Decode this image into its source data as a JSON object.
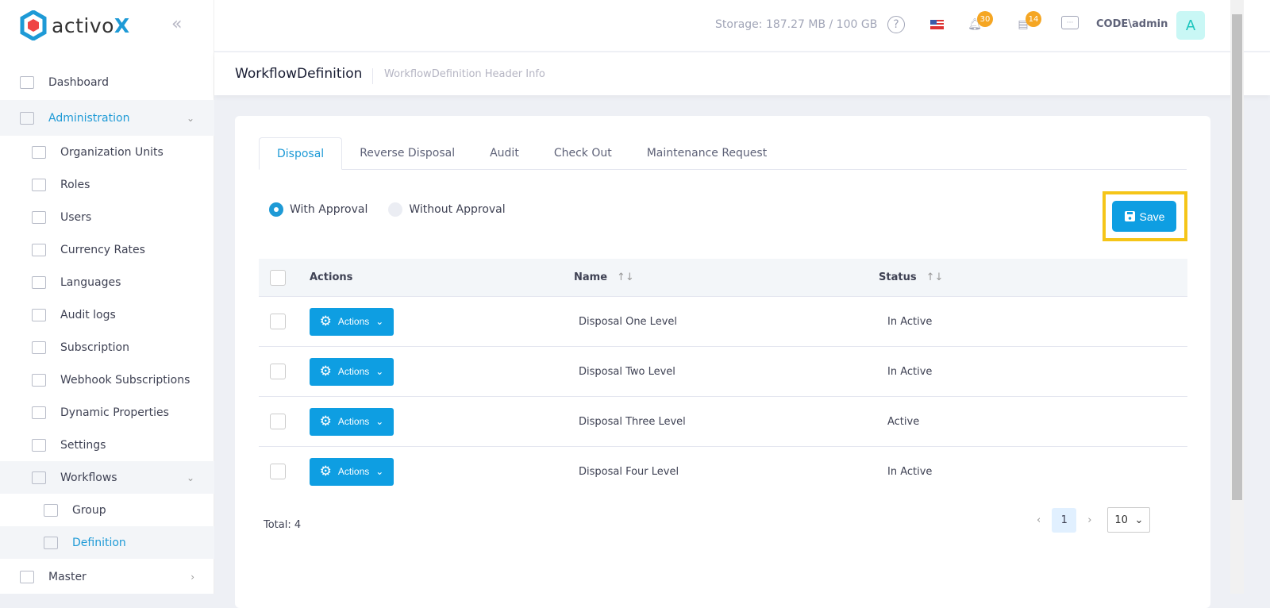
{
  "brand": {
    "name_prefix": "activo",
    "name_suffix": "X"
  },
  "sidebar": {
    "items": [
      {
        "label": "Dashboard",
        "level": 0
      },
      {
        "label": "Administration",
        "level": 0,
        "expanded": true,
        "band": true,
        "active": true
      },
      {
        "label": "Organization Units",
        "level": 1
      },
      {
        "label": "Roles",
        "level": 1
      },
      {
        "label": "Users",
        "level": 1
      },
      {
        "label": "Currency Rates",
        "level": 1
      },
      {
        "label": "Languages",
        "level": 1
      },
      {
        "label": "Audit logs",
        "level": 1
      },
      {
        "label": "Subscription",
        "level": 1
      },
      {
        "label": "Webhook Subscriptions",
        "level": 1
      },
      {
        "label": "Dynamic Properties",
        "level": 1
      },
      {
        "label": "Settings",
        "level": 1
      },
      {
        "label": "Workflows",
        "level": 1,
        "expanded": true,
        "band": true
      },
      {
        "label": "Group",
        "level": 2
      },
      {
        "label": "Definition",
        "level": 2,
        "band": true,
        "active": true
      },
      {
        "label": "Master",
        "level": 0,
        "collapsed": true
      }
    ]
  },
  "topbar": {
    "storage": "Storage: 187.27 MB / 100 GB",
    "notifications_count": "30",
    "tasks_count": "14",
    "user": "CODE\\admin",
    "avatar_letter": "A"
  },
  "header": {
    "title": "WorkflowDefinition",
    "info": "WorkflowDefinition Header Info"
  },
  "tabs": [
    "Disposal",
    "Reverse Disposal",
    "Audit",
    "Check Out",
    "Maintenance Request"
  ],
  "options": {
    "with_approval": "With Approval",
    "without_approval": "Without Approval",
    "selected": "With Approval"
  },
  "save_label": "Save",
  "table": {
    "headers": {
      "actions": "Actions",
      "name": "Name",
      "status": "Status"
    },
    "action_label": "Actions",
    "rows": [
      {
        "name": "Disposal One Level",
        "status": "In Active"
      },
      {
        "name": "Disposal Two Level",
        "status": "In Active"
      },
      {
        "name": "Disposal Three Level",
        "status": "Active"
      },
      {
        "name": "Disposal Four Level",
        "status": "In Active"
      }
    ]
  },
  "footer": {
    "total": "Total: 4",
    "page": "1",
    "page_size": "10"
  },
  "colors": {
    "accent": "#0e9ee2",
    "highlight": "#f5c518",
    "badge": "#f5a623"
  }
}
